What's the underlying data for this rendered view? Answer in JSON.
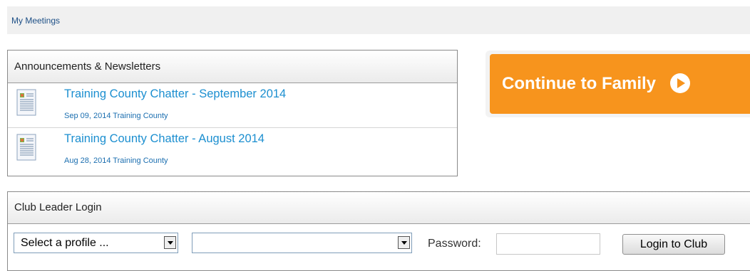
{
  "topbar": {
    "link_label": "My Meetings"
  },
  "announcements": {
    "header": "Announcements & Newsletters",
    "items": [
      {
        "icon": "document-icon",
        "title": "Training County Chatter - September 2014",
        "meta": "Sep 09, 2014 Training County"
      },
      {
        "icon": "document-icon",
        "title": "Training County Chatter - August 2014",
        "meta": "Aug 28, 2014 Training County"
      }
    ]
  },
  "continue_button": {
    "label": "Continue to Family",
    "icon": "play-circle-icon",
    "color": "#f7941d"
  },
  "login": {
    "header": "Club Leader Login",
    "profile_select": {
      "value": "Select a profile ..."
    },
    "club_select": {
      "value": ""
    },
    "password_label": "Password:",
    "password_value": "",
    "button_label": "Login to Club"
  },
  "colors": {
    "link": "#1c8fd0",
    "accent": "#f7941d"
  }
}
